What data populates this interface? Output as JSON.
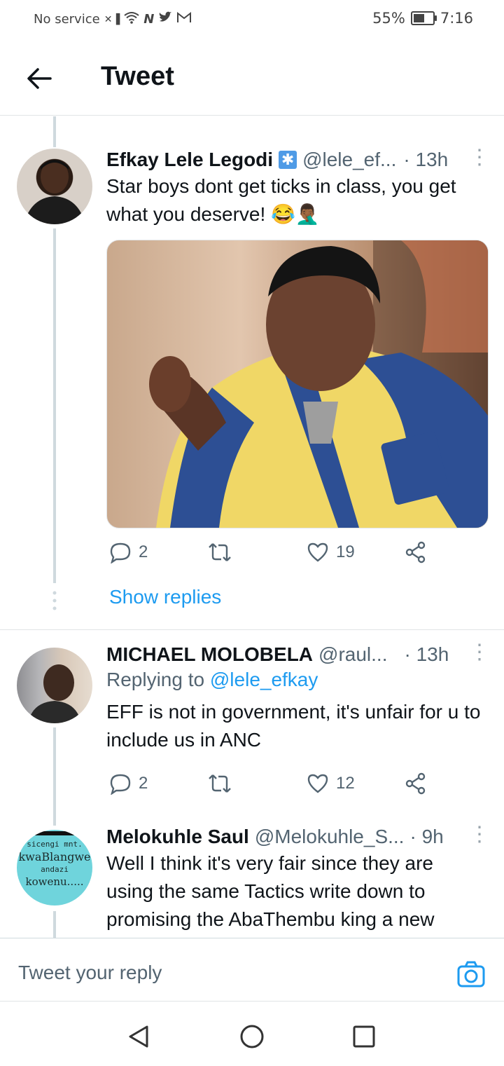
{
  "status_bar": {
    "carrier": "No service",
    "battery": "55%",
    "battery_level": 0.55,
    "time": "7:16"
  },
  "header": {
    "title": "Tweet"
  },
  "tweets": [
    {
      "name": "Efkay Lele Legodi",
      "handle": "@lele_ef...",
      "time": "· 13h",
      "text": "Star boys dont get ticks in class, you get what you deserve! 😂🤦🏾‍♂️",
      "image_alt": "boy in yellow and blue jacket gesturing",
      "replies": "2",
      "likes": "19"
    },
    {
      "name": "MICHAEL MOLOBELA",
      "handle": "@raul...",
      "time": "· 13h",
      "replying_label": "Replying to ",
      "replying_handle": "@lele_efkay",
      "text": "EFF is not in government, it's unfair for u to include us in ANC",
      "replies": "2",
      "likes": "12"
    },
    {
      "name": "Melokuhle Saul",
      "handle": "@Melokuhle_S...",
      "time": "· 9h",
      "text": "Well I think it's very fair since they are using the same Tactics write down to promising  the AbaThembu king a new",
      "avatar_lines": [
        "sicengi mnt.",
        "kwaBlangwe",
        "andazi",
        "kowenu....."
      ]
    }
  ],
  "show_replies": "Show replies",
  "compose": {
    "placeholder": "Tweet your reply"
  },
  "colors": {
    "accent": "#1d9bf0",
    "secondary_text": "#536471"
  }
}
